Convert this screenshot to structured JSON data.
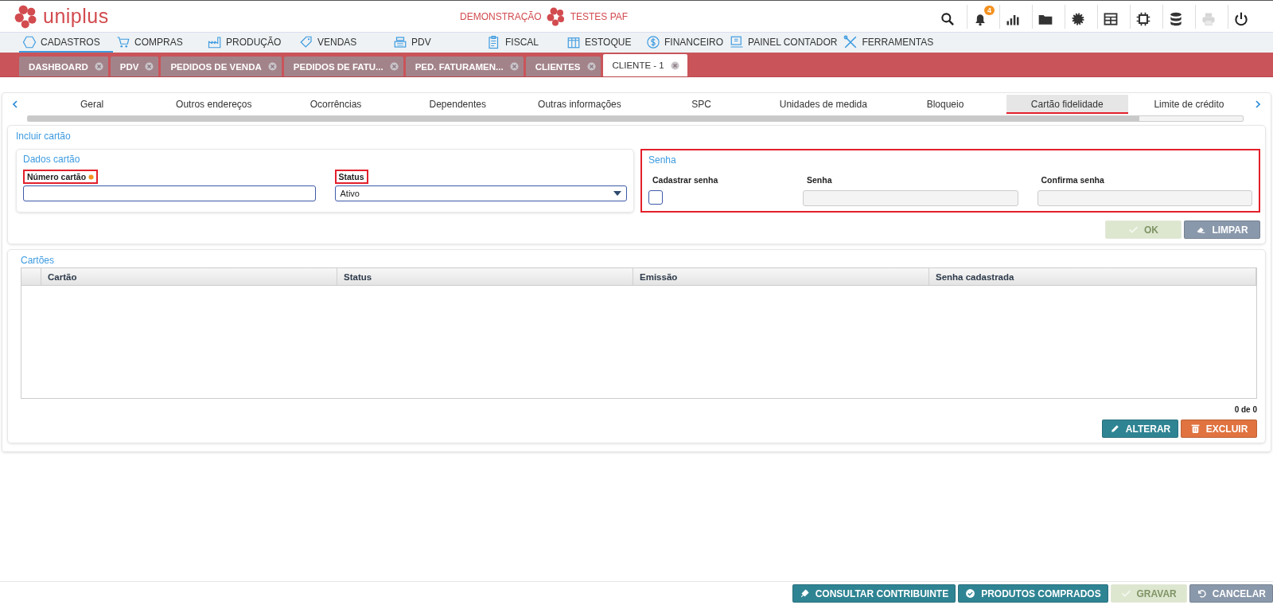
{
  "header": {
    "logo": "uniplus",
    "environment": "DEMONSTRAÇÃO",
    "company": "TESTES PAF",
    "tools": [
      {
        "disabled": false
      },
      {
        "disabled": false,
        "badge": "4"
      },
      {
        "disabled": false
      },
      {
        "disabled": false
      },
      {
        "disabled": false
      },
      {
        "disabled": false
      },
      {
        "disabled": false
      },
      {
        "disabled": false
      },
      {
        "disabled": true
      },
      {
        "disabled": false
      }
    ]
  },
  "menu": [
    {
      "label": "CADASTROS",
      "selected": true
    },
    {
      "label": "COMPRAS",
      "selected": false
    },
    {
      "label": "PRODUÇÃO",
      "selected": false
    },
    {
      "label": "VENDAS",
      "selected": false
    },
    {
      "label": "PDV",
      "selected": false
    },
    {
      "label": "FISCAL",
      "selected": false
    },
    {
      "label": "ESTOQUE",
      "selected": false
    },
    {
      "label": "FINANCEIRO",
      "selected": false
    },
    {
      "label": "PAINEL CONTADOR",
      "selected": false
    },
    {
      "label": "FERRAMENTAS",
      "selected": false
    }
  ],
  "open_tabs": [
    {
      "label": "DASHBOARD",
      "selected": false
    },
    {
      "label": "PDV",
      "selected": false
    },
    {
      "label": "PEDIDOS DE VENDA",
      "selected": false
    },
    {
      "label": "PEDIDOS DE FATU...",
      "selected": false
    },
    {
      "label": "PED. FATURAMEN...",
      "selected": false
    },
    {
      "label": "CLIENTES",
      "selected": false
    },
    {
      "label": "CLIENTE - 1",
      "selected": true
    }
  ],
  "sub_tabs": [
    {
      "label": "Geral",
      "selected": false
    },
    {
      "label": "Outros endereços",
      "selected": false
    },
    {
      "label": "Ocorrências",
      "selected": false
    },
    {
      "label": "Dependentes",
      "selected": false
    },
    {
      "label": "Outras informações",
      "selected": false
    },
    {
      "label": "SPC",
      "selected": false
    },
    {
      "label": "Unidades de medida",
      "selected": false
    },
    {
      "label": "Bloqueio",
      "selected": false
    },
    {
      "label": "Cartão fidelidade",
      "selected": true
    },
    {
      "label": "Limite de crédito",
      "selected": false
    }
  ],
  "form": {
    "title": "Incluir cartão",
    "card_data": {
      "title": "Dados cartão",
      "fields": [
        {
          "kind": "text",
          "label": "Número cartão",
          "required": true,
          "highlighted": true
        },
        {
          "kind": "select",
          "label": "Status",
          "value": "Ativo",
          "highlighted": true
        }
      ]
    },
    "password": {
      "title": "Senha",
      "highlighted": true,
      "fields": [
        {
          "kind": "checkbox",
          "label": "Cadastrar senha",
          "checked": false
        },
        {
          "kind": "text",
          "label": "Senha",
          "disabled": true
        },
        {
          "kind": "text",
          "label": "Confirma senha",
          "disabled": true
        }
      ]
    },
    "buttons": [
      {
        "label": "OK",
        "kind": "confirm",
        "disabled": true
      },
      {
        "label": "LIMPAR",
        "kind": "clear",
        "disabled": false
      }
    ]
  },
  "cards": {
    "title": "Cartões",
    "columns": [
      "Cartão",
      "Status",
      "Emissão",
      "Senha cadastrada"
    ],
    "pager": "0 de 0",
    "buttons": [
      {
        "label": "ALTERAR",
        "kind": "edit",
        "disabled": false
      },
      {
        "label": "EXCLUIR",
        "kind": "delete",
        "disabled": false
      }
    ]
  },
  "footer": [
    {
      "label": "CONSULTAR CONTRIBUINTE",
      "kind": "lookup",
      "disabled": false
    },
    {
      "label": "PRODUTOS COMPRADOS",
      "kind": "products",
      "disabled": false
    },
    {
      "label": "GRAVAR",
      "kind": "confirm",
      "disabled": true
    },
    {
      "label": "CANCELAR",
      "kind": "cancel",
      "disabled": false
    }
  ]
}
